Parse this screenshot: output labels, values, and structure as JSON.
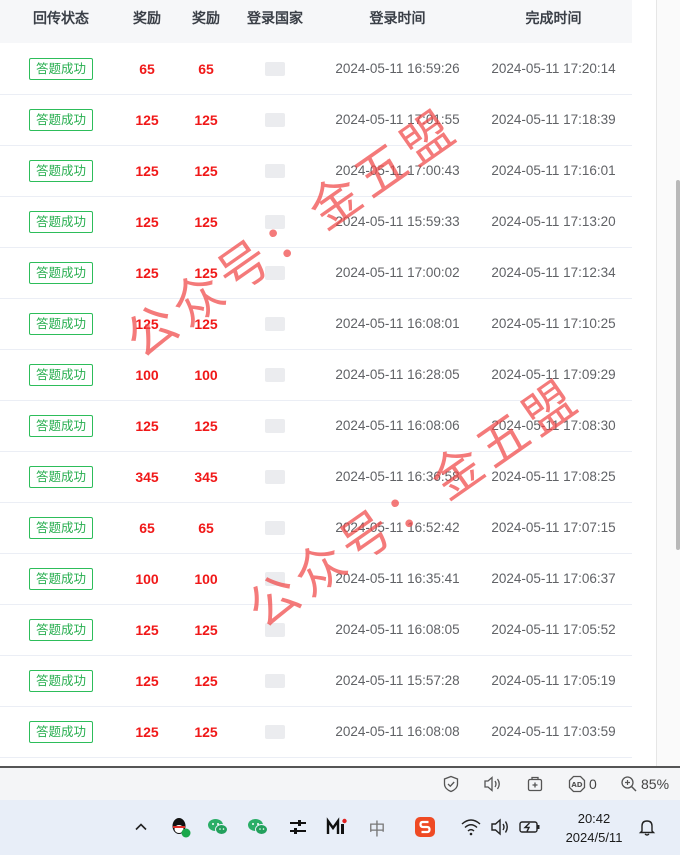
{
  "table": {
    "columns": [
      "回传状态",
      "奖励",
      "奖励",
      "登录国家",
      "登录时间",
      "完成时间"
    ],
    "rows": [
      {
        "status": "答题成功",
        "reward_a": "65",
        "reward_b": "65",
        "login_time": "2024-05-11 16:59:26",
        "done_time": "2024-05-11 17:20:14"
      },
      {
        "status": "答题成功",
        "reward_a": "125",
        "reward_b": "125",
        "login_time": "2024-05-11 17:01:55",
        "done_time": "2024-05-11 17:18:39"
      },
      {
        "status": "答题成功",
        "reward_a": "125",
        "reward_b": "125",
        "login_time": "2024-05-11 17:00:43",
        "done_time": "2024-05-11 17:16:01"
      },
      {
        "status": "答题成功",
        "reward_a": "125",
        "reward_b": "125",
        "login_time": "2024-05-11 15:59:33",
        "done_time": "2024-05-11 17:13:20"
      },
      {
        "status": "答题成功",
        "reward_a": "125",
        "reward_b": "125",
        "login_time": "2024-05-11 17:00:02",
        "done_time": "2024-05-11 17:12:34"
      },
      {
        "status": "答题成功",
        "reward_a": "125",
        "reward_b": "125",
        "login_time": "2024-05-11 16:08:01",
        "done_time": "2024-05-11 17:10:25"
      },
      {
        "status": "答题成功",
        "reward_a": "100",
        "reward_b": "100",
        "login_time": "2024-05-11 16:28:05",
        "done_time": "2024-05-11 17:09:29"
      },
      {
        "status": "答题成功",
        "reward_a": "125",
        "reward_b": "125",
        "login_time": "2024-05-11 16:08:06",
        "done_time": "2024-05-11 17:08:30"
      },
      {
        "status": "答题成功",
        "reward_a": "345",
        "reward_b": "345",
        "login_time": "2024-05-11 16:36:58",
        "done_time": "2024-05-11 17:08:25"
      },
      {
        "status": "答题成功",
        "reward_a": "65",
        "reward_b": "65",
        "login_time": "2024-05-11 16:52:42",
        "done_time": "2024-05-11 17:07:15"
      },
      {
        "status": "答题成功",
        "reward_a": "100",
        "reward_b": "100",
        "login_time": "2024-05-11 16:35:41",
        "done_time": "2024-05-11 17:06:37"
      },
      {
        "status": "答题成功",
        "reward_a": "125",
        "reward_b": "125",
        "login_time": "2024-05-11 16:08:05",
        "done_time": "2024-05-11 17:05:52"
      },
      {
        "status": "答题成功",
        "reward_a": "125",
        "reward_b": "125",
        "login_time": "2024-05-11 15:57:28",
        "done_time": "2024-05-11 17:05:19"
      },
      {
        "status": "答题成功",
        "reward_a": "125",
        "reward_b": "125",
        "login_time": "2024-05-11 16:08:08",
        "done_time": "2024-05-11 17:03:59"
      }
    ]
  },
  "watermarks": [
    "公众号：金五盟",
    "公众号：金五盟"
  ],
  "browser_status": {
    "adblock_count": "0",
    "zoom": "85%"
  },
  "taskbar": {
    "ime": "中",
    "time": "20:42",
    "date": "2024/5/11"
  },
  "colors": {
    "success": "#27ae4f",
    "reward": "#f01818",
    "watermark": "#f04646"
  },
  "icons": [
    "chevron-up-icon",
    "qq-icon",
    "wechat-icon",
    "wechat-icon",
    "sliders-icon",
    "m-app-icon",
    "ime-icon",
    "sogou-icon",
    "wifi-icon",
    "speaker-icon",
    "battery-icon",
    "bell-icon",
    "shield-check-icon",
    "read-aloud-icon",
    "add-tab-icon",
    "adblock-icon",
    "zoom-in-icon"
  ]
}
